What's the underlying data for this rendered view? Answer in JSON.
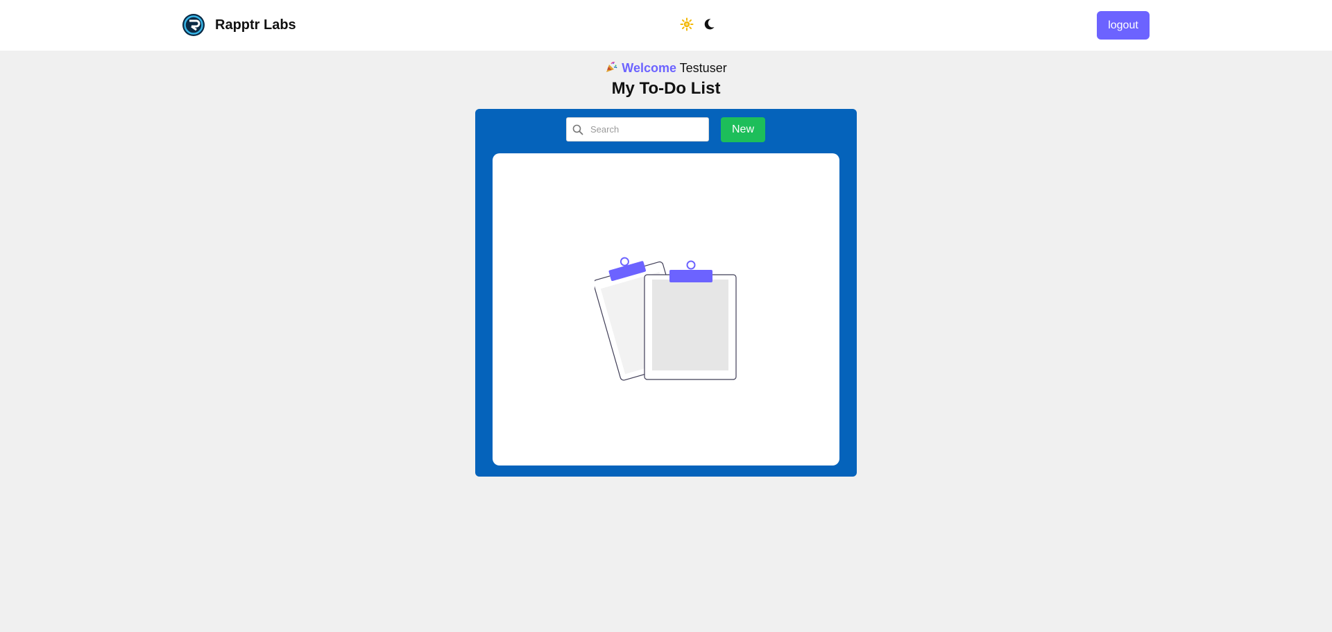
{
  "navbar": {
    "brand_name": "Rapptr Labs",
    "logo_icon": "rapptr-logo-icon",
    "theme_icons": [
      "sun-icon",
      "moon-icon"
    ],
    "logout_label": "logout"
  },
  "welcome": {
    "emoji_icon": "party-popper-icon",
    "greeting": "Welcome",
    "username": "Testuser"
  },
  "page_title": "My To-Do List",
  "todo": {
    "search_placeholder": "Search",
    "search_value": "",
    "new_label": "New",
    "empty_state_icon": "empty-clipboards-illustration"
  },
  "colors": {
    "accent": "#6c63ff",
    "panel": "#0563bb",
    "new_button": "#1dbe5a",
    "background": "#f0f0f0",
    "sun": "#f2b705"
  }
}
